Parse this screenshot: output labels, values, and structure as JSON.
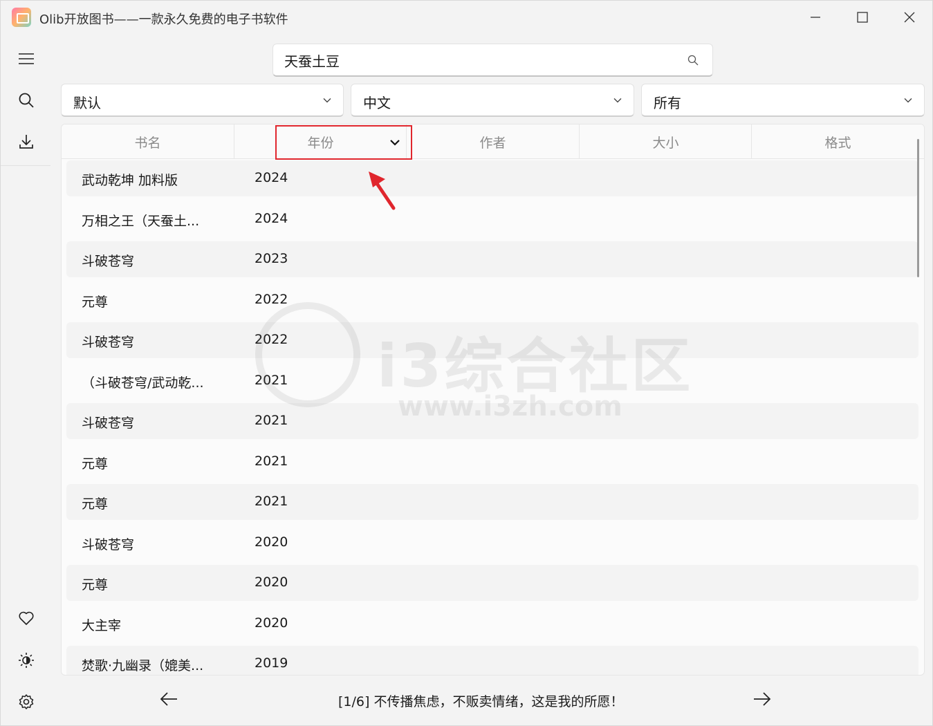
{
  "window": {
    "title": "Olib开放图书——一款永久免费的电子书软件"
  },
  "search": {
    "value": "天蚕土豆",
    "icon": "search-icon"
  },
  "filters": {
    "sort": "默认",
    "language": "中文",
    "format": "所有"
  },
  "table": {
    "headers": [
      "书名",
      "年份",
      "作者",
      "大小",
      "格式"
    ],
    "rows": [
      {
        "title": "武动乾坤 加料版",
        "year": "2024"
      },
      {
        "title": "万相之王（天蚕土...",
        "year": "2024"
      },
      {
        "title": "斗破苍穹",
        "year": "2023"
      },
      {
        "title": "元尊",
        "year": "2022"
      },
      {
        "title": "斗破苍穹",
        "year": "2022"
      },
      {
        "title": "（斗破苍穹/武动乾...",
        "year": "2021"
      },
      {
        "title": "斗破苍穹",
        "year": "2021"
      },
      {
        "title": "元尊",
        "year": "2021"
      },
      {
        "title": "元尊",
        "year": "2021"
      },
      {
        "title": "斗破苍穹",
        "year": "2020"
      },
      {
        "title": "元尊",
        "year": "2020"
      },
      {
        "title": "大主宰",
        "year": "2020"
      },
      {
        "title": "焚歌·九幽录（媲美...",
        "year": "2019"
      }
    ]
  },
  "footer": {
    "text": "[1/6] 不传播焦虑，不贩卖情绪，这是我的所愿！"
  },
  "watermark": {
    "title": "i3综合社区",
    "url": "www.i3zh.com"
  },
  "colors": {
    "annotation": "#e0262d",
    "background": "#f3f3f3"
  }
}
